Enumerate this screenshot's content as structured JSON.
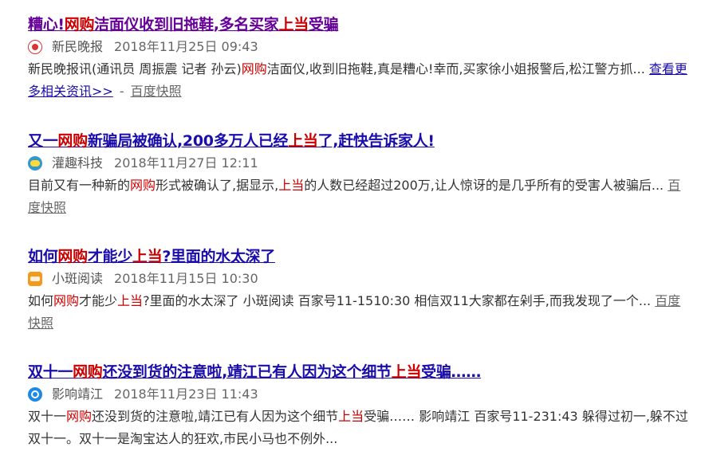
{
  "results": [
    {
      "title": [
        "糟心!",
        "网购",
        "洁面仪收到旧拖鞋,多名买家",
        "上当",
        "受骗"
      ],
      "source": "新民晚报",
      "source_icon": "xinmin-logo-icon",
      "date": "2018年11月25日 09:43",
      "abstract": [
        "新民晚报讯(通讯员 周振震 记者 孙云)",
        "网购",
        "洁面仪,收到旧拖鞋,真是糟心!幸而,买家徐小姐报警后,松江警方抓... "
      ],
      "more_link": "查看更多相关资讯>>",
      "separator": "-",
      "snapshot": "百度快照"
    },
    {
      "title": [
        "又一",
        "网购",
        "新骗局被确认,200多万人已经",
        "上当",
        "了,赶快告诉家人!"
      ],
      "source": "灌趣科技",
      "source_icon": "guanqu-logo-icon",
      "date": "2018年11月27日 12:11",
      "abstract": [
        "目前又有一种新的",
        "网购",
        "形式被确认了,据显示,",
        "上当",
        "的人数已经超过200万,让人惊讶的是几乎所有的受害人被骗后... "
      ],
      "snapshot": "百度快照"
    },
    {
      "title": [
        "如何",
        "网购",
        "才能少",
        "上当",
        "?里面的水太深了"
      ],
      "source": "小斑阅读",
      "source_icon": "xiaoban-logo-icon",
      "date": "2018年11月15日 10:30",
      "abstract": [
        "如何",
        "网购",
        "才能少",
        "上当",
        "?里面的水太深了 小斑阅读 百家号11-1510:30 相信双11大家都在剁手,而我发现了一个... "
      ],
      "snapshot": "百度快照"
    },
    {
      "title": [
        "双十一",
        "网购",
        "还没到货的注意啦,靖江已有人因为这个细节",
        "上当",
        "受骗……"
      ],
      "source": "影响靖江",
      "source_icon": "yingxiang-logo-icon",
      "date": "2018年11月23日 11:43",
      "abstract": [
        "双十一",
        "网购",
        "还没到货的注意啦,靖江已有人因为这个细节",
        "上当",
        "受骗…… 影响靖江 百家号11-231:43 躲得过初一,躲不过双十一。双十一是淘宝达人的狂欢,市民小马也不例外..."
      ]
    }
  ]
}
